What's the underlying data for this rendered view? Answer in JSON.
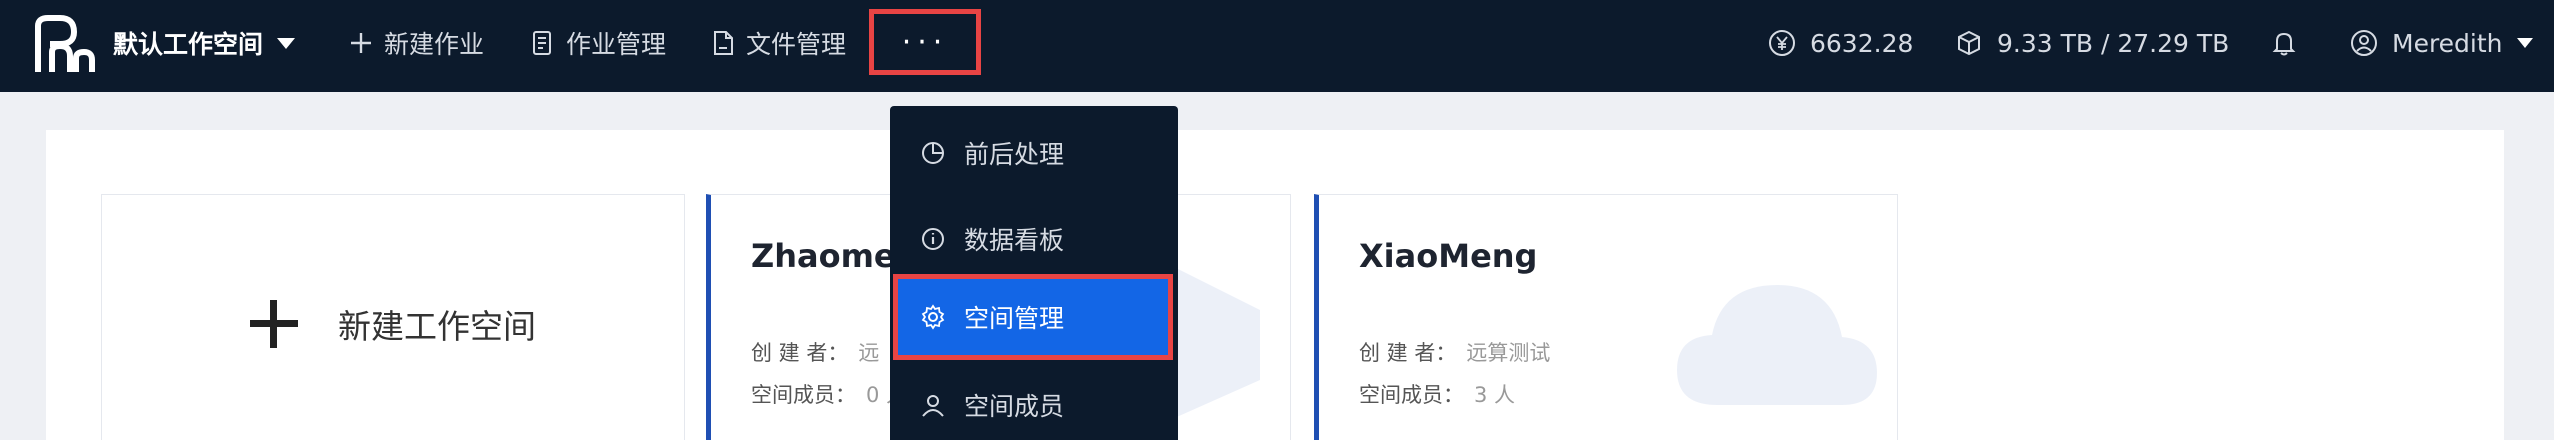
{
  "topbar": {
    "workspace_name": "默认工作空间",
    "nav": {
      "new_job": "新建作业",
      "job_manage": "作业管理",
      "file_manage": "文件管理",
      "more": "···"
    },
    "balance": "6632.28",
    "storage": "9.33 TB / 27.29 TB",
    "user": "Meredith"
  },
  "dropdown": {
    "items": [
      {
        "label": "前后处理",
        "icon": "pie-icon"
      },
      {
        "label": "数据看板",
        "icon": "info-icon"
      },
      {
        "label": "空间管理",
        "icon": "gear-icon"
      },
      {
        "label": "空间成员",
        "icon": "user-icon"
      }
    ]
  },
  "cards": {
    "new_label": "新建工作空间",
    "creator_label": "创 建 者：",
    "members_label": "空间成员：",
    "ws1": {
      "title": "Zhaomeir",
      "creator": "远",
      "members": "0 人"
    },
    "ws2": {
      "title": "XiaoMeng",
      "creator": "远算测试",
      "members": "3 人"
    }
  },
  "colors": {
    "nav_bg": "#0c1a2c",
    "accent": "#1366e6",
    "highlight": "#e84444",
    "card_border": "#1f4fb3"
  }
}
